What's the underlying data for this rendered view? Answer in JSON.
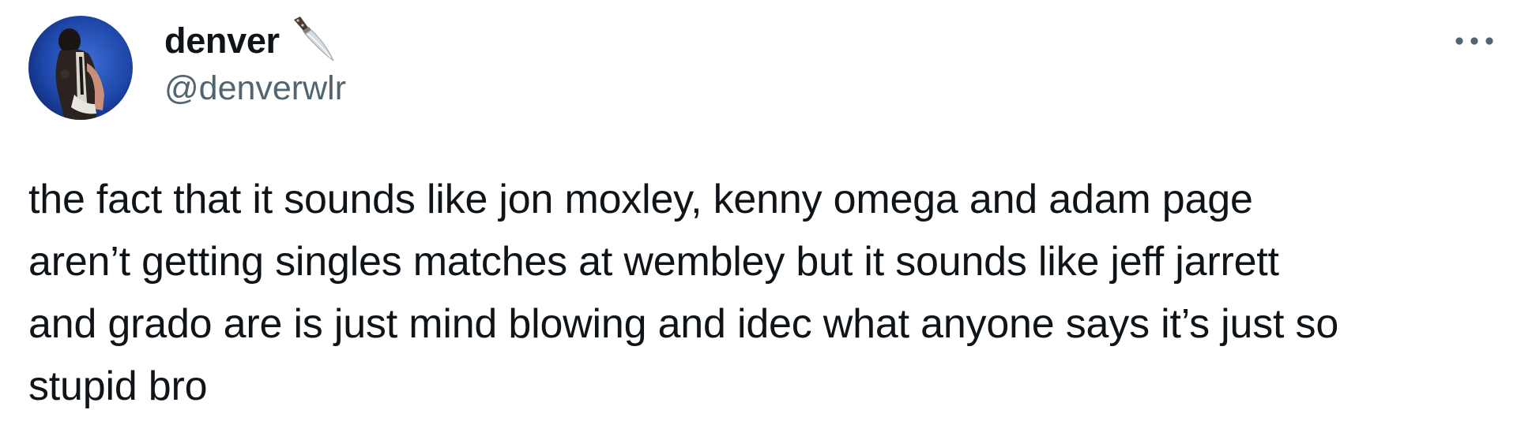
{
  "author": {
    "display_name": "denver",
    "handle": "@denverwlr",
    "avatar_icon": "wrestler-avatar-icon",
    "name_emoji_icon": "knife-icon"
  },
  "actions": {
    "more_icon": "ellipsis-icon"
  },
  "tweet": {
    "lines": [
      "the fact that it sounds like jon moxley, kenny omega and adam page",
      "aren’t getting singles matches at wembley but it sounds like jeff jarrett",
      "and grado are is just mind blowing and idec what anyone says it’s just so",
      "stupid bro"
    ]
  },
  "colors": {
    "text": "#0f1419",
    "secondary_text": "#536471",
    "avatar_bg": "#1a3a8a"
  }
}
